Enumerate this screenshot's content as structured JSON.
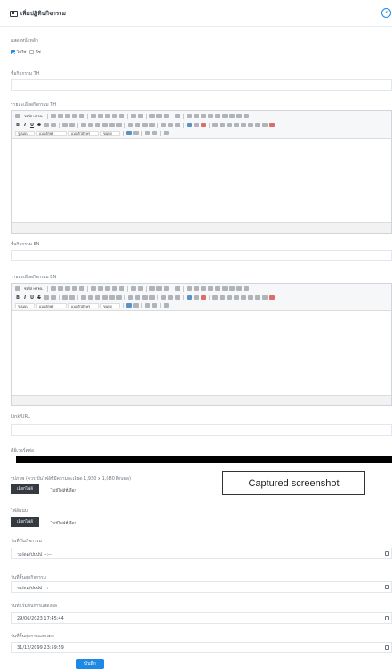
{
  "header": {
    "title": "เพิ่มปฏิทินกิจกรรม",
    "title_icon": "calendar-icon",
    "back_icon": "arrow-left-circle-icon"
  },
  "form": {
    "display_home_label": "แสดงหน้าหลัก",
    "show_options": [
      {
        "label": "ไม่ใช่",
        "checked": true
      },
      {
        "label": "ใช่",
        "checked": false
      }
    ],
    "name_th_label": "ชื่อกิจกรรม TH",
    "detail_th_label": "รายละเอียดกิจกรรม TH",
    "name_en_label": "ชื่อกิจกรรม EN",
    "detail_en_label": "รายละเอียดกิจกรรม EN",
    "link_label": "Link/URL",
    "tags_label": "คีย์เวอร์ดต่อ",
    "image_label": "รูปภาพ (ควรเป็นไฟล์ที่มีความละเอียด 1,920 x 1,080 พิกเซล)",
    "image_button": "เลือกไฟล์",
    "image_file": "ไม่มีไฟล์ที่เลือก",
    "attach_label": "ไฟล์แนบ",
    "attach_button": "เลือกไฟล์",
    "attach_file": "ไม่มีไฟล์ที่เลือก",
    "start_date_label": "วันที่เริ่มกิจกรรม",
    "start_date_value": "วว/ดด/ปปปป --:--",
    "end_date_label": "วันที่สิ้นสุดกิจกรรม",
    "end_date_value": "วว/ดด/ปปปป --:--",
    "publish_start_label": "วันที่ เริ่มต้นการแสดงผล",
    "publish_start_value": "29/06/2023 17:45:44",
    "publish_end_label": "วันที่สิ้นสุดการแสดงผล",
    "publish_end_value": "31/12/2099 23:59:59",
    "save_label": "บันทึก"
  },
  "editor": {
    "source_label": "ซอร์ส HTML",
    "styles_label": "รูปแบบ",
    "format_label": "แบบอักษร",
    "font_label": "แบบตัวอักษร",
    "size_label": "ขนาด"
  },
  "overlay": {
    "caption": "Captured screenshot"
  },
  "colors": {
    "accent": "#1e88e5",
    "dark_button": "#343a40"
  }
}
